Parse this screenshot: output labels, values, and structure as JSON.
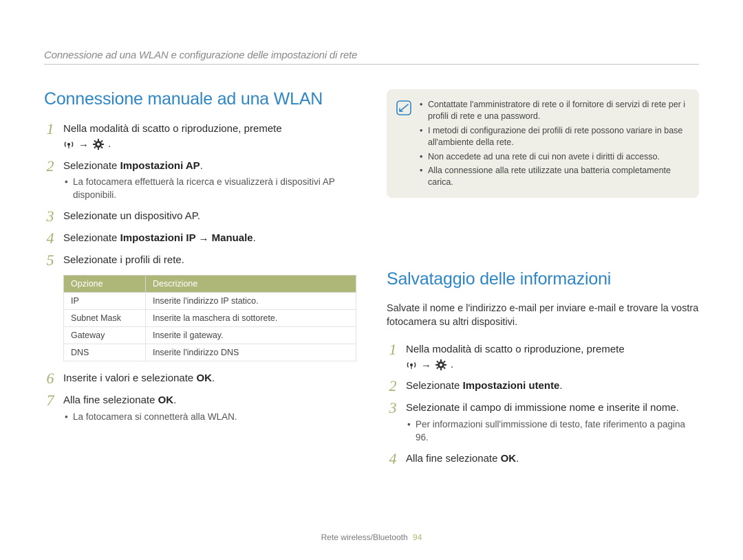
{
  "header": {
    "breadcrumb": "Connessione ad una WLAN e configurazione delle impostazioni di rete"
  },
  "left": {
    "title": "Connessione manuale ad una WLAN",
    "steps": {
      "1": "Nella modalità di scatto o riproduzione, premete",
      "1_tail": ".",
      "2_pre": "Selezionate ",
      "2_bold": "Impostazioni AP",
      "2_post": ".",
      "2_sub": "La fotocamera effettuerà la ricerca e visualizzerà i dispositivi AP disponibili.",
      "3": "Selezionate un dispositivo AP.",
      "4_pre": "Selezionate ",
      "4_bold": "Impostazioni IP → Manuale",
      "4_post": ".",
      "5": "Selezionate i profili di rete.",
      "6_pre": "Inserite i valori e selezionate ",
      "6_bold": "OK",
      "6_post": ".",
      "7_pre": "Alla fine selezionate ",
      "7_bold": "OK",
      "7_post": ".",
      "7_sub": "La fotocamera si connetterà alla WLAN."
    },
    "table": {
      "h1": "Opzione",
      "h2": "Descrizione",
      "r1c1": "IP",
      "r1c2": "Inserite l'indirizzo IP statico.",
      "r2c1": "Subnet Mask",
      "r2c2": "Inserite la maschera di sottorete.",
      "r3c1": "Gateway",
      "r3c2": "Inserite il gateway.",
      "r4c1": "DNS",
      "r4c2": "Inserite l'indirizzo DNS"
    }
  },
  "right": {
    "note": {
      "n1": "Contattate l'amministratore di rete o il fornitore di servizi di rete per i profili di rete e una password.",
      "n2": "I metodi di configurazione dei profili di rete possono variare in base all'ambiente della rete.",
      "n3": "Non accedete ad una rete di cui non avete i diritti di accesso.",
      "n4": "Alla connessione alla rete utilizzate una batteria completamente carica."
    },
    "title": "Salvataggio delle informazioni",
    "intro": "Salvate il nome e l'indirizzo e-mail per inviare e-mail e trovare la vostra fotocamera su altri dispositivi.",
    "steps": {
      "1": "Nella modalità di scatto o riproduzione, premete",
      "1_tail": ".",
      "2_pre": "Selezionate ",
      "2_bold": "Impostazioni utente",
      "2_post": ".",
      "3": "Selezionate il campo di immissione nome e inserite il nome.",
      "3_sub": "Per informazioni sull'immissione di testo, fate riferimento a pagina 96.",
      "4_pre": "Alla fine selezionate ",
      "4_bold": "OK",
      "4_post": "."
    }
  },
  "footer": {
    "section": "Rete wireless/Bluetooth",
    "page": "94"
  }
}
